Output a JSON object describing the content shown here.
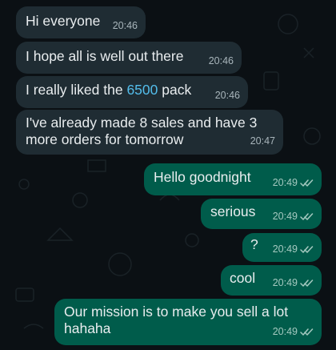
{
  "messages": [
    {
      "direction": "incoming",
      "text": "Hi everyone",
      "time": "20:46"
    },
    {
      "direction": "incoming",
      "text": "I hope all is well out there",
      "time": "20:46"
    },
    {
      "direction": "incoming",
      "text_before": "I really liked the ",
      "highlight": "6500",
      "text_after": " pack",
      "time": "20:46"
    },
    {
      "direction": "incoming",
      "text": "I've already made 8 sales and have 3 more orders for tomorrow",
      "time": "20:47"
    },
    {
      "direction": "outgoing",
      "text": "Hello goodnight",
      "time": "20:49",
      "status_icon": "double-check-icon"
    },
    {
      "direction": "outgoing",
      "text": "serious",
      "time": "20:49",
      "status_icon": "double-check-icon"
    },
    {
      "direction": "outgoing",
      "text": "?",
      "time": "20:49",
      "status_icon": "double-check-icon"
    },
    {
      "direction": "outgoing",
      "text": "cool",
      "time": "20:49",
      "status_icon": "double-check-icon"
    },
    {
      "direction": "outgoing",
      "text": "Our mission is to make you sell a lot hahaha",
      "time": "20:49",
      "status_icon": "double-check-icon"
    }
  ],
  "colors": {
    "background": "#0b1014",
    "incoming_bubble": "#1f2c33",
    "outgoing_bubble": "#005c4b",
    "text": "#e9edef",
    "link": "#53bdeb"
  }
}
